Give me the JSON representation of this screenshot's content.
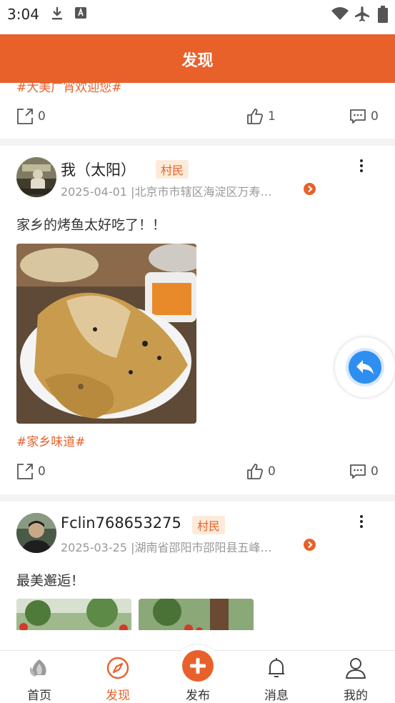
{
  "status_bar": {
    "time": "3:04"
  },
  "header": {
    "title": "发现"
  },
  "feed": {
    "top_partial": {
      "tag_text": "#大美广宵欢迎您#",
      "share_count": "0",
      "like_count": "1",
      "comment_count": "0"
    },
    "posts": [
      {
        "username": "我（太阳）",
        "badge": "村民",
        "meta": "2025-04-01 |北京市市辖区海淀区万寿…",
        "content": "家乡的烤鱼太好吃了！！",
        "hashtag": "#家乡味道#",
        "share_count": "0",
        "like_count": "0",
        "comment_count": "0"
      },
      {
        "username": "Fclin768653275",
        "badge": "村民",
        "meta": "2025-03-25 |湖南省邵阳市邵阳县五峰…",
        "content": "最美邂逅！"
      }
    ]
  },
  "tabbar": {
    "items": [
      {
        "label": "首页",
        "icon": "home-icon"
      },
      {
        "label": "发现",
        "icon": "compass-icon"
      },
      {
        "label": "发布",
        "icon": "plus-icon"
      },
      {
        "label": "消息",
        "icon": "bell-icon"
      },
      {
        "label": "我的",
        "icon": "person-icon"
      }
    ]
  },
  "colors": {
    "accent": "#e8612a",
    "float_button": "#2f8ff0"
  }
}
